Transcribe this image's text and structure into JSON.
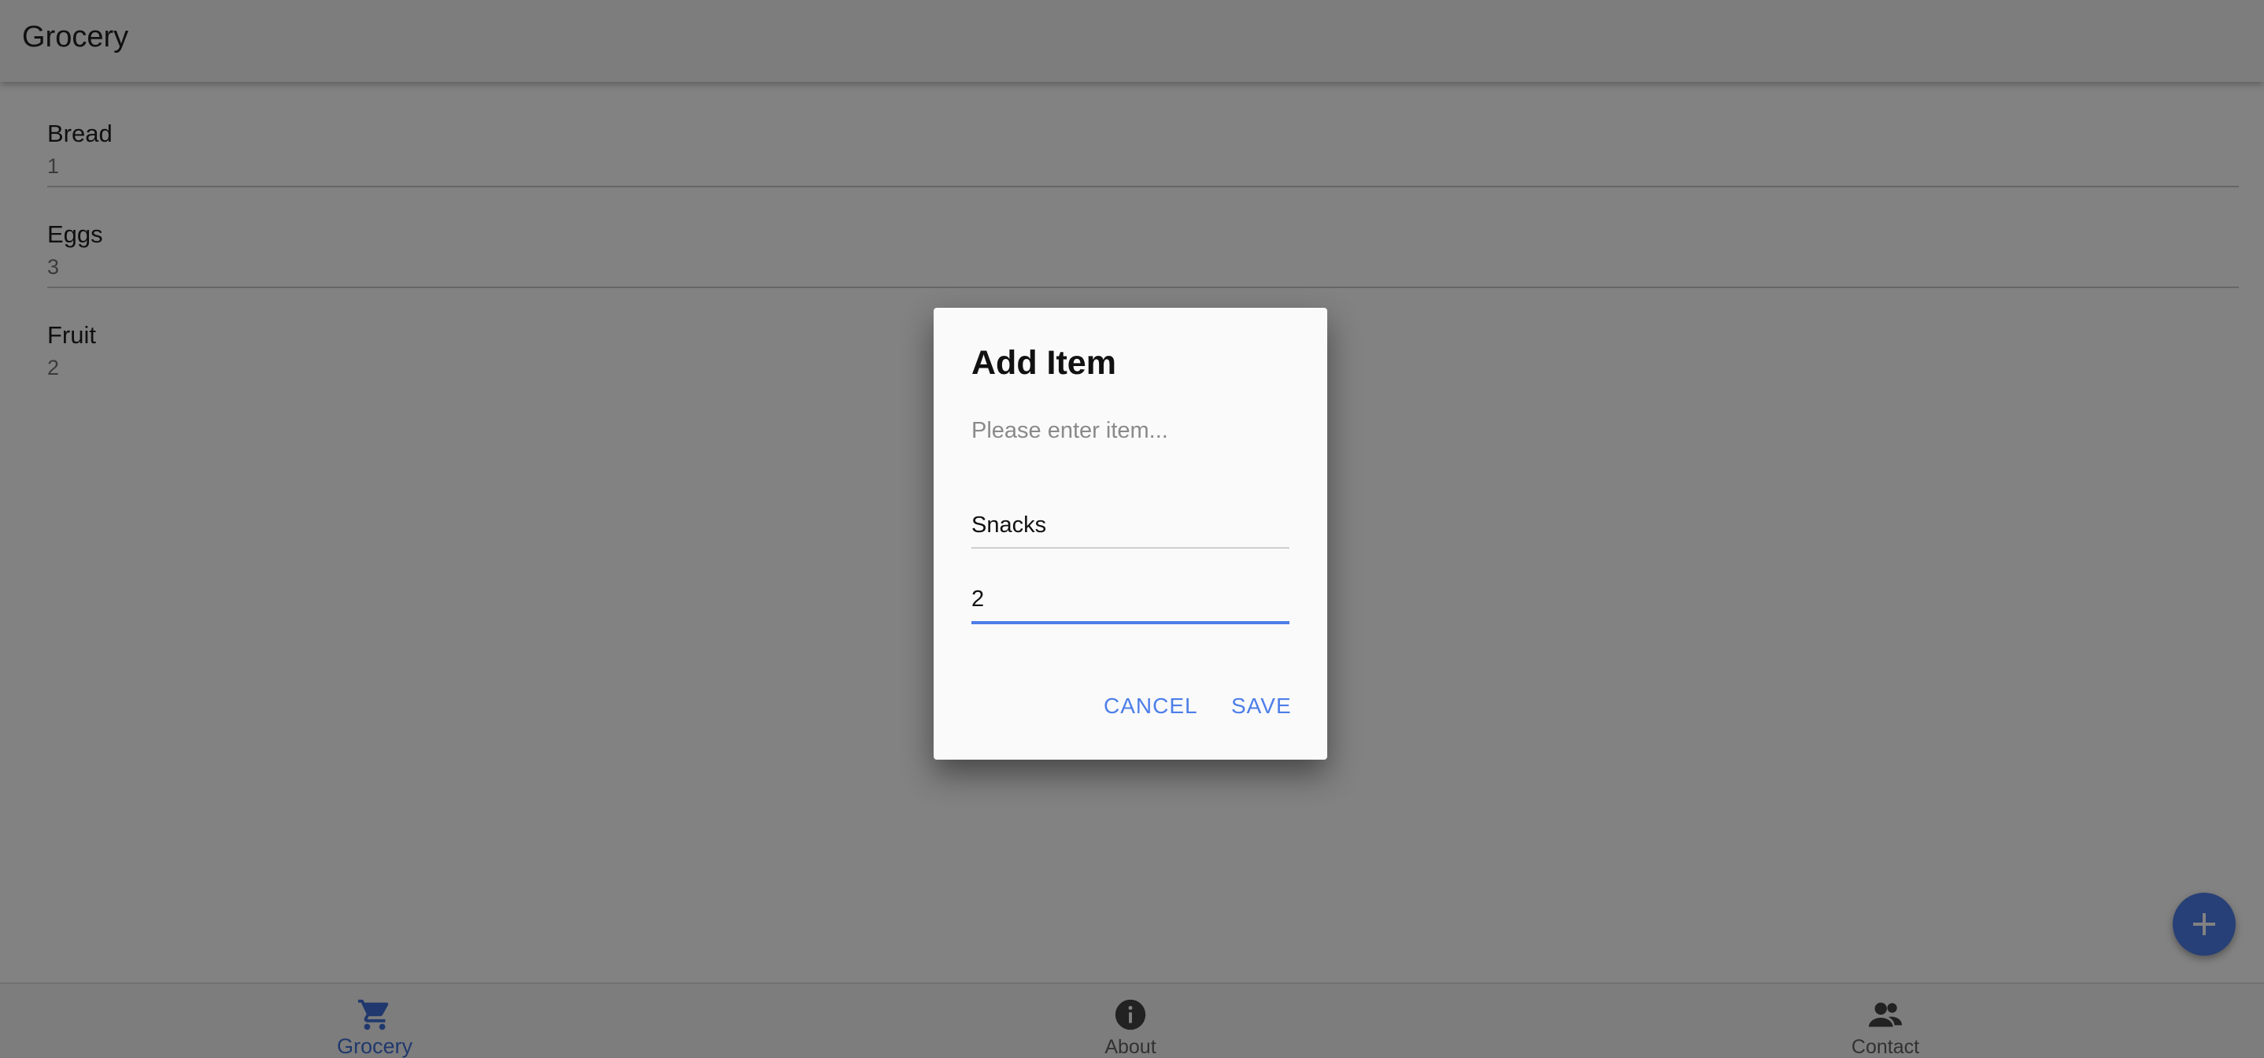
{
  "app": {
    "title": "Grocery"
  },
  "grocery_list": [
    {
      "name": "Bread",
      "quantity": "1"
    },
    {
      "name": "Eggs",
      "quantity": "3"
    },
    {
      "name": "Fruit",
      "quantity": "2"
    }
  ],
  "bottom_nav": {
    "tabs": [
      {
        "label": "Grocery",
        "icon": "cart-icon",
        "active": true
      },
      {
        "label": "About",
        "icon": "info-icon",
        "active": false
      },
      {
        "label": "Contact",
        "icon": "contacts-icon",
        "active": false
      }
    ]
  },
  "fab": {
    "icon": "plus-icon"
  },
  "dialog": {
    "title": "Add Item",
    "message": "Please enter item...",
    "name_value": "Snacks",
    "quantity_value": "2",
    "cancel_label": "CANCEL",
    "save_label": "SAVE"
  },
  "colors": {
    "accent": "#4d7ee9",
    "active_tab": "#3f6ed6",
    "scrim": "rgba(0,0,0,0.49)"
  }
}
